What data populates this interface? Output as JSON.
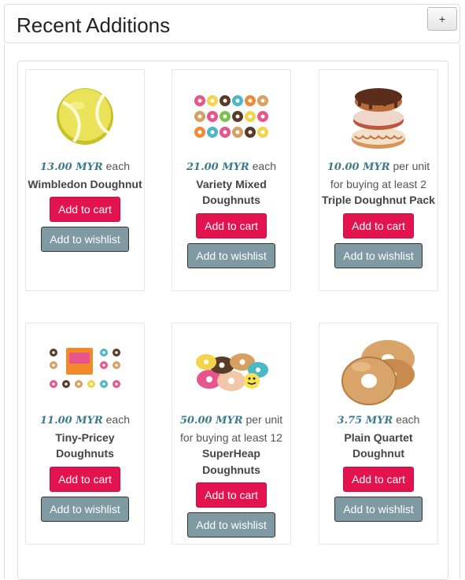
{
  "header": {
    "title": "Recent Additions",
    "toggle_label": "+"
  },
  "products": [
    {
      "price": "13.00 MYR",
      "unit": " each",
      "name": "Wimbledon Doughnut",
      "cart_label": "Add to cart",
      "wish_label": "Add to wishlist",
      "icon": "tennis-ball-doughnut-icon"
    },
    {
      "price": "21.00 MYR",
      "unit": " each",
      "name": "Variety Mixed Doughnuts",
      "cart_label": "Add to cart",
      "wish_label": "Add to wishlist",
      "icon": "mixed-doughnuts-icon"
    },
    {
      "price": "10.00 MYR",
      "unit": " per unit for buying at least 2",
      "name": "Triple Doughnut Pack",
      "cart_label": "Add to cart",
      "wish_label": "Add to wishlist",
      "icon": "stacked-doughnuts-icon"
    },
    {
      "price": "11.00 MYR",
      "unit": " each",
      "name": "Tiny-Pricey Doughnuts",
      "cart_label": "Add to cart",
      "wish_label": "Add to wishlist",
      "icon": "mini-doughnut-box-icon"
    },
    {
      "price": "50.00 MYR",
      "unit": " per unit for buying at least 12",
      "name": "SuperHeap Doughnuts",
      "cart_label": "Add to cart",
      "wish_label": "Add to wishlist",
      "icon": "doughnut-heap-icon"
    },
    {
      "price": "3.75 MYR",
      "unit": " each",
      "name": "Plain Quartet Doughnut",
      "cart_label": "Add to cart",
      "wish_label": "Add to wishlist",
      "icon": "plain-doughnut-stack-icon"
    }
  ]
}
